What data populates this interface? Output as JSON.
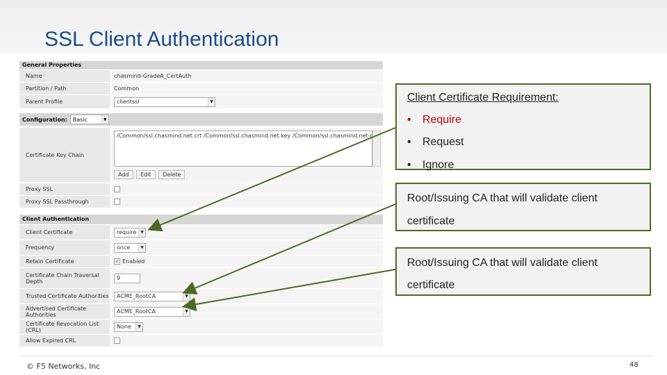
{
  "slide": {
    "title": "SSL Client Authentication",
    "footer": "© F5 Networks, Inc",
    "page_number": "48"
  },
  "panel": {
    "general_header": "General Properties",
    "name_label": "Name",
    "name_value": "chasmind-GradeA_CertAuth",
    "partition_label": "Partition / Path",
    "partition_value": "Common",
    "parent_label": "Parent Profile",
    "parent_value": "clientssl",
    "configuration_label": "Configuration:",
    "configuration_value": "Basic",
    "keychain_label": "Certificate Key Chain",
    "keychain_value": "/Common/ssl.chasmind.net.crt /Common/ssl.chasmind.net.key /Common/ssl.chasmind.net-chain.crt",
    "add_label": "Add",
    "edit_label": "Edit",
    "delete_label": "Delete",
    "proxy_ssl_label": "Proxy SSL",
    "proxy_passthrough_label": "Proxy SSL Passthrough",
    "client_auth_header": "Client Authentication",
    "client_cert_label": "Client Certificate",
    "client_cert_value": "require",
    "frequency_label": "Frequency",
    "frequency_value": "once",
    "retain_label": "Retain Certificate",
    "retain_value": "Enabled",
    "depth_label_1": "Certificate Chain Traversal",
    "depth_label_2": "Depth",
    "depth_value": "9",
    "trusted_label": "Trusted Certificate Authorities",
    "trusted_value": "ACME_RootCA",
    "advertised_label": "Advertised Certificate Authorities",
    "advertised_value": "ACME_RootCA",
    "crl_label": "Certificate Revocation List (CRL)",
    "crl_value": "None",
    "expired_crl_label": "Allow Expired CRL"
  },
  "callouts": {
    "box1_title": "Client Certificate Requirement:",
    "box1_items": [
      "Require",
      "Request",
      "Ignore"
    ],
    "box2_line1": "Root/Issuing CA that will validate client",
    "box2_line2": "certificate",
    "box3_line1": "Root/Issuing CA that will validate client",
    "box3_line2": "certificate"
  },
  "colors": {
    "title": "#1b4b8a",
    "arrow": "#4a6a26",
    "highlight": "#c00000"
  }
}
